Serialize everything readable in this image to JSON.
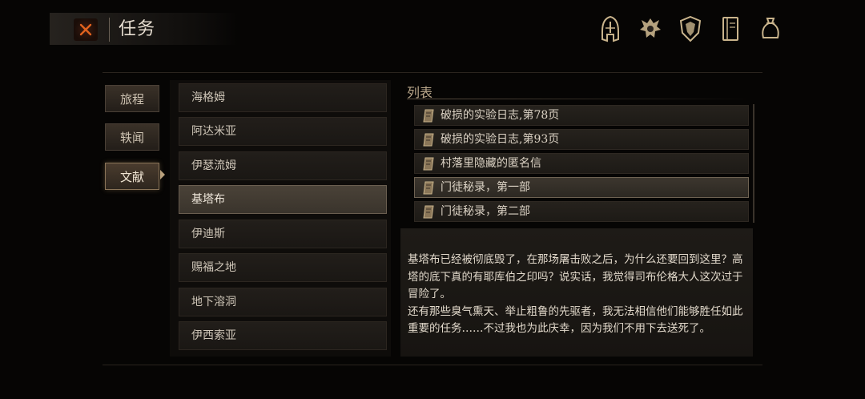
{
  "header": {
    "title": "任务",
    "close_icon": "close-x-icon",
    "nav_icons": [
      "helmet-icon",
      "crest-icon",
      "shield-icon",
      "journal-icon",
      "pouch-icon"
    ]
  },
  "categories": [
    {
      "label": "旅程",
      "active": false
    },
    {
      "label": "轶闻",
      "active": false
    },
    {
      "label": "文献",
      "active": true
    }
  ],
  "locations": [
    {
      "label": "海格姆",
      "selected": false
    },
    {
      "label": "阿达米亚",
      "selected": false
    },
    {
      "label": "伊瑟流姆",
      "selected": false
    },
    {
      "label": "基塔布",
      "selected": true
    },
    {
      "label": "伊迪斯",
      "selected": false
    },
    {
      "label": "赐福之地",
      "selected": false
    },
    {
      "label": "地下溶洞",
      "selected": false
    },
    {
      "label": "伊西索亚",
      "selected": false
    }
  ],
  "documents": {
    "heading": "列表",
    "items": [
      {
        "label": "破损的实验日志,第78页",
        "selected": false
      },
      {
        "label": "破损的实验日志,第93页",
        "selected": false
      },
      {
        "label": "村落里隐藏的匿名信",
        "selected": false
      },
      {
        "label": "门徒秘录，第一部",
        "selected": true
      },
      {
        "label": "门徒秘录，第二部",
        "selected": false
      }
    ]
  },
  "description": {
    "paragraph1": "基塔布已经被彻底毁了，在那场屠击败之后，为什么还要回到这里？高塔的底下真的有耶库伯之印吗？说实话，我觉得司布伦格大人这次过于冒险了。",
    "paragraph2": "还有那些臭气熏天、举止粗鲁的先驱者，我无法相信他们能够胜任如此重要的任务……不过我也为此庆幸，因为我们不用下去送死了。"
  },
  "colors": {
    "accent": "#e0621e",
    "gold": "#c9b48c"
  }
}
